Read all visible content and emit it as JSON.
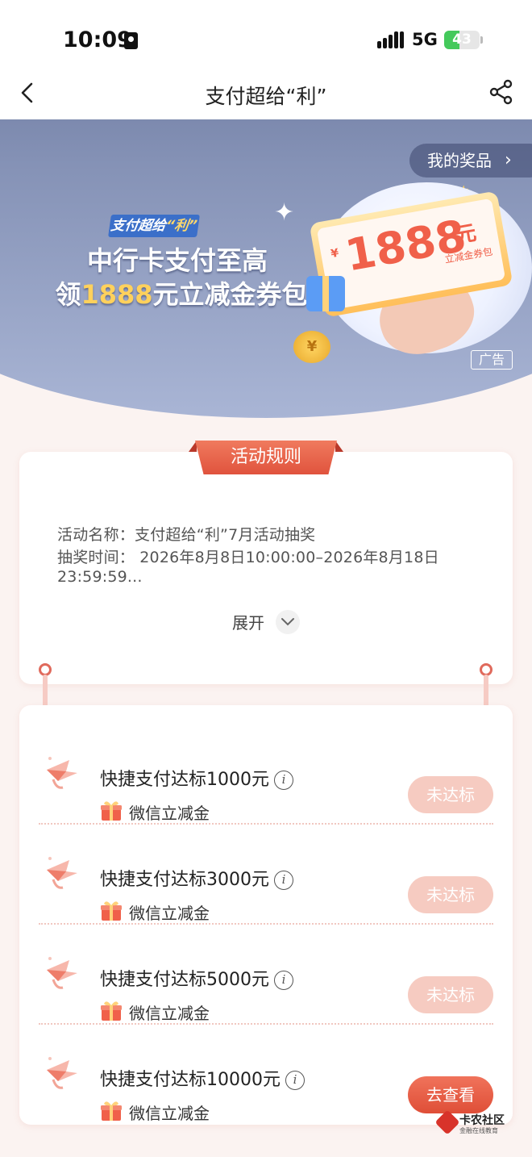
{
  "status_bar": {
    "time": "10:09",
    "network": "5G",
    "battery": "43",
    "battery_level": 0.43
  },
  "nav": {
    "title": "支付超给“利”"
  },
  "banner": {
    "my_prizes": "我的奖品",
    "badge_prefix": "支付超给",
    "badge_highlight": "“利”",
    "headline_1": "中行卡支付至高",
    "headline_2_prefix": "领",
    "headline_2_amount": "1888",
    "headline_2_suffix": "元立减金券包",
    "ticket_currency": "¥",
    "ticket_amount": "1888",
    "ticket_unit": "元",
    "ticket_sub": "立减金券包",
    "ad_label": "广告"
  },
  "rules": {
    "ribbon": "活动规则",
    "line1": "活动名称：支付超给“利”7月活动抽奖",
    "line2": "抽奖时间： 2026年8月8日10:00:00–2026年8月18日",
    "line3": "23:59:59...",
    "expand": "展开"
  },
  "tasks": [
    {
      "name": "快捷支付达标1000元",
      "reward": "微信立减金",
      "button": "未达标",
      "active": false
    },
    {
      "name": "快捷支付达标3000元",
      "reward": "微信立减金",
      "button": "未达标",
      "active": false
    },
    {
      "name": "快捷支付达标5000元",
      "reward": "微信立减金",
      "button": "未达标",
      "active": false
    },
    {
      "name": "快捷支付达标10000元",
      "reward": "微信立减金",
      "button": "去查看",
      "active": true
    }
  ],
  "info_glyph": "i",
  "watermark": {
    "name": "卡农社区",
    "tagline": "金融在线教育"
  },
  "colors": {
    "accent": "#e0533d",
    "button_disabled": "#f6cbc1",
    "banner": "#7d8ab0"
  }
}
